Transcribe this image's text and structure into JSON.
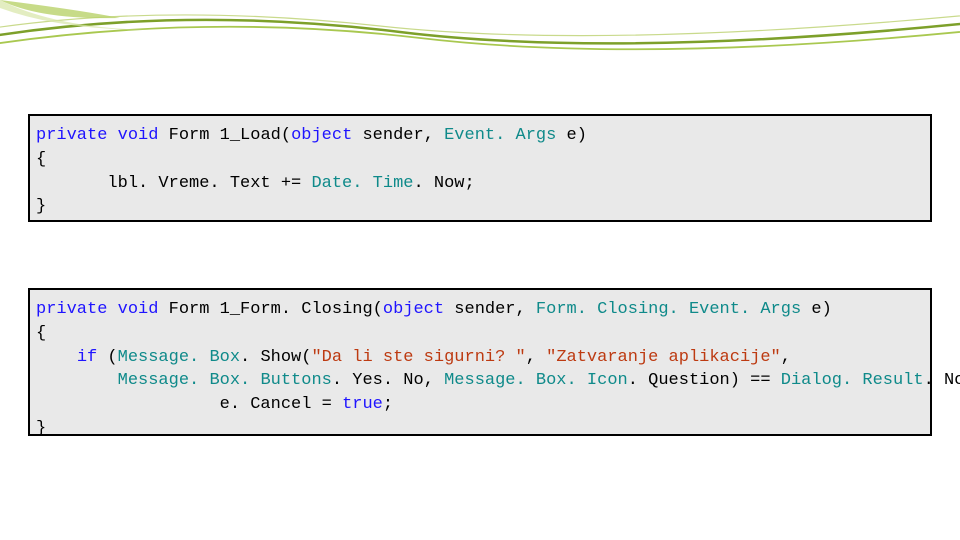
{
  "code1": {
    "kw_private": "private",
    "kw_void": "void",
    "fn_name": " Form 1_Load(",
    "kw_object": "object",
    "after_object": " sender, ",
    "type_eventargs": "Event. Args",
    "after_eventargs": " e)",
    "brace_open": "{",
    "body_indent": "       lbl. Vreme. Text += ",
    "type_datetime": "Date. Time",
    "after_datetime": ". Now;",
    "brace_close": "}"
  },
  "code2": {
    "kw_private": "private",
    "kw_void": "void",
    "fn_name": " Form 1_Form. Closing(",
    "kw_object": "object",
    "after_object": " sender, ",
    "type_fcea": "Form. Closing. Event. Args",
    "after_fcea": " e)",
    "brace_open": "{",
    "if_indent": "    ",
    "kw_if": "if",
    "after_if": " (",
    "type_msgbox": "Message. Box",
    "after_msgbox": ". Show(",
    "str1": "\"Da li ste sigurni? \"",
    "comma1": ", ",
    "str2": "\"Zatvaranje aplikacije\"",
    "comma2": ",",
    "line3_indent": "        ",
    "type_buttons": "Message. Box. Buttons",
    "after_buttons": ". Yes. No, ",
    "type_icon": "Message. Box. Icon",
    "after_icon": ". Question) == ",
    "type_dialog": "Dialog. Result",
    "after_dialog": ". No)",
    "line4_indent": "                  e. Cancel = ",
    "kw_true": "true",
    "semicolon": ";",
    "brace_close": "}"
  }
}
